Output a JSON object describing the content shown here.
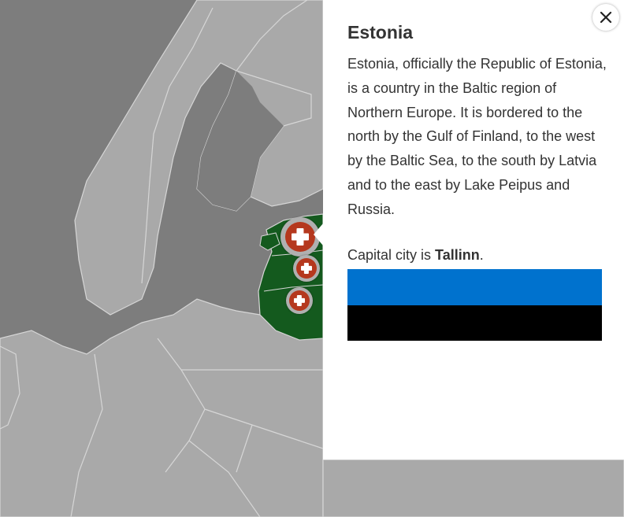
{
  "map": {
    "colors": {
      "sea": "#7d7d7d",
      "land": "#a9a9a9",
      "borders": "#d6d6d6",
      "selected_region": "#145a1e"
    },
    "markers": [
      {
        "name": "marker-estonia",
        "icon": "plus-icon",
        "selected": true
      },
      {
        "name": "marker-latvia",
        "icon": "plus-icon",
        "selected": false
      },
      {
        "name": "marker-lithuania",
        "icon": "plus-icon",
        "selected": false
      }
    ]
  },
  "panel": {
    "title": "Estonia",
    "description": "Estonia, officially the Republic of Estonia, is a country in the Baltic region of Northern Europe. It is bordered to the north by the Gulf of Finland, to the west by the Baltic Sea, to the south by Latvia and to the east by Lake Peipus and Russia.",
    "capital_prefix": "Capital city is ",
    "capital_name": "Tallinn",
    "capital_suffix": ".",
    "flag_colors": [
      "#0072ce",
      "#000000",
      "#ffffff"
    ],
    "close_icon": "close-icon"
  }
}
